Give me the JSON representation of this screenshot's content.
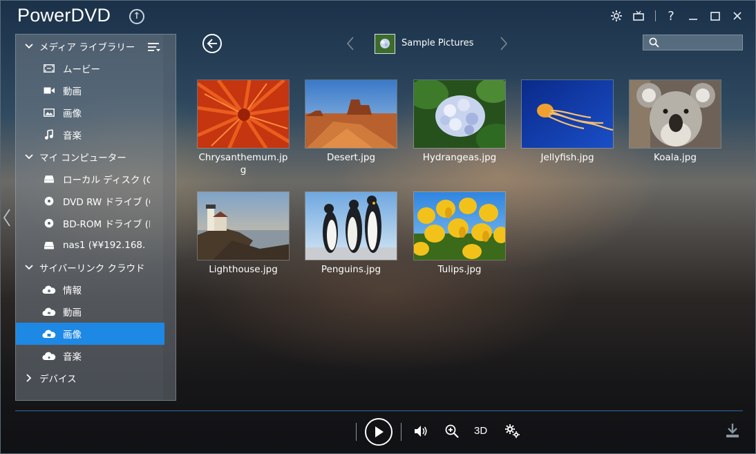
{
  "app": {
    "title": "PowerDVD"
  },
  "sidebar": {
    "sections": [
      {
        "label": "メディア ライブラリー",
        "expanded": true
      },
      {
        "label": "マイ コンピューター",
        "expanded": true
      },
      {
        "label": "サイバーリンク クラウド",
        "expanded": true
      },
      {
        "label": "デバイス",
        "expanded": false
      }
    ],
    "media_library": [
      {
        "label": "ムービー",
        "icon": "film-icon"
      },
      {
        "label": "動画",
        "icon": "video-camera-icon"
      },
      {
        "label": "画像",
        "icon": "image-icon"
      },
      {
        "label": "音楽",
        "icon": "music-note-icon"
      }
    ],
    "my_computer": [
      {
        "label": "ローカル ディスク (C:)",
        "icon": "hard-drive-icon"
      },
      {
        "label": "DVD RW ドライブ (Q",
        "icon": "disc-icon"
      },
      {
        "label": "BD-ROM ドライブ (R",
        "icon": "disc-icon"
      },
      {
        "label": "nas1 (¥¥192.168.",
        "icon": "network-drive-icon"
      }
    ],
    "cloud": [
      {
        "label": "情報",
        "icon": "cloud-icon"
      },
      {
        "label": "動画",
        "icon": "cloud-icon"
      },
      {
        "label": "画像",
        "icon": "cloud-icon",
        "selected": true
      },
      {
        "label": "音楽",
        "icon": "cloud-icon"
      }
    ]
  },
  "header": {
    "folder_name": "Sample Pictures",
    "search_placeholder": ""
  },
  "files": [
    {
      "name": "Chrysanthemum.jpg",
      "thumb": "chrysanthemum"
    },
    {
      "name": "Desert.jpg",
      "thumb": "desert"
    },
    {
      "name": "Hydrangeas.jpg",
      "thumb": "hydrangeas"
    },
    {
      "name": "Jellyfish.jpg",
      "thumb": "jellyfish"
    },
    {
      "name": "Koala.jpg",
      "thumb": "koala"
    },
    {
      "name": "Lighthouse.jpg",
      "thumb": "lighthouse"
    },
    {
      "name": "Penguins.jpg",
      "thumb": "penguins"
    },
    {
      "name": "Tulips.jpg",
      "thumb": "tulips"
    }
  ],
  "player": {
    "label_3d": "3D"
  },
  "colors": {
    "accent": "#1e88e5",
    "rule": "#2f68a8"
  }
}
